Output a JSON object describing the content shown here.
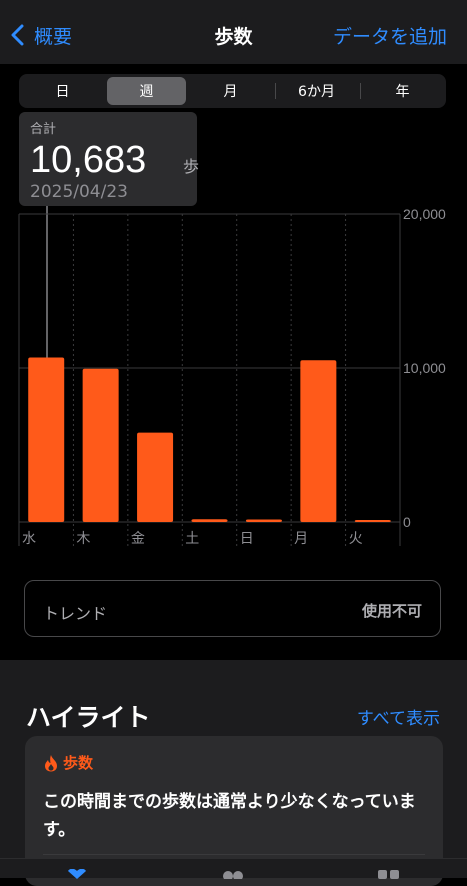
{
  "nav": {
    "back_label": "概要",
    "title": "歩数",
    "action_label": "データを追加"
  },
  "segments": [
    {
      "label": "日",
      "active": false
    },
    {
      "label": "週",
      "active": true
    },
    {
      "label": "月",
      "active": false
    },
    {
      "label": "6か月",
      "active": false
    },
    {
      "label": "年",
      "active": false
    }
  ],
  "selection": {
    "label": "合計",
    "value": "10,683",
    "unit": "歩",
    "date": "2025/04/23"
  },
  "chart_data": {
    "type": "bar",
    "categories": [
      "水",
      "木",
      "金",
      "土",
      "日",
      "月",
      "火"
    ],
    "values": [
      10683,
      9950,
      5800,
      180,
      160,
      10500,
      60
    ],
    "y_tick_labels": [
      "20,000",
      "10,000",
      "0"
    ],
    "ylim": [
      0,
      20000
    ],
    "bar_color": "#ff5a1a",
    "grid": true
  },
  "trend": {
    "label": "トレンド",
    "status": "使用不可"
  },
  "highlights": {
    "title": "ハイライト",
    "show_all_label": "すべて表示",
    "card": {
      "category": "歩数",
      "text": "この時間までの歩数は通常より少なくなっています。"
    }
  },
  "colors": {
    "accent": "#2f8cff",
    "bar": "#ff5a1a"
  }
}
